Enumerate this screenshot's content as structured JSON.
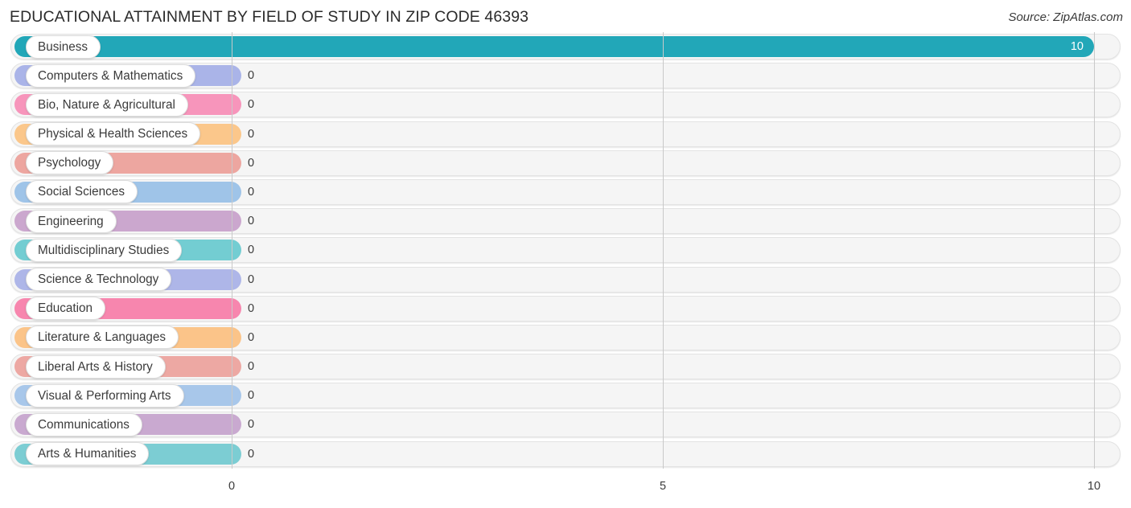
{
  "header": {
    "title": "EDUCATIONAL ATTAINMENT BY FIELD OF STUDY IN ZIP CODE 46393",
    "source": "Source: ZipAtlas.com"
  },
  "axis": {
    "ticks": [
      "0",
      "5",
      "10"
    ],
    "tick_values": [
      0,
      5,
      10
    ]
  },
  "chart_data": {
    "type": "bar",
    "orientation": "horizontal",
    "title": "EDUCATIONAL ATTAINMENT BY FIELD OF STUDY IN ZIP CODE 46393",
    "subtitle": "",
    "xlabel": "",
    "ylabel": "",
    "xlim": [
      0,
      10
    ],
    "grid": true,
    "legend": null,
    "source": "Source: ZipAtlas.com",
    "categories": [
      "Business",
      "Computers & Mathematics",
      "Bio, Nature & Agricultural",
      "Physical & Health Sciences",
      "Psychology",
      "Social Sciences",
      "Engineering",
      "Multidisciplinary Studies",
      "Science & Technology",
      "Education",
      "Literature & Languages",
      "Liberal Arts & History",
      "Visual & Performing Arts",
      "Communications",
      "Arts & Humanities"
    ],
    "values": [
      10,
      0,
      0,
      0,
      0,
      0,
      0,
      0,
      0,
      0,
      0,
      0,
      0,
      0,
      0
    ],
    "value_labels": [
      "10",
      "0",
      "0",
      "0",
      "0",
      "0",
      "0",
      "0",
      "0",
      "0",
      "0",
      "0",
      "0",
      "0",
      "0"
    ],
    "colors": [
      "#22a7b8",
      "#aab4e8",
      "#f795bb",
      "#fbc78b",
      "#eda6a0",
      "#9fc4e8",
      "#cba7ce",
      "#73cdd2",
      "#aeb6e8",
      "#f786ae",
      "#fbc489",
      "#eda8a3",
      "#a8c7ea",
      "#c9a9d0",
      "#7ccdd3"
    ]
  },
  "rows": [
    {
      "label": "Business",
      "value": 10,
      "value_label": "10",
      "color": "#22a7b8",
      "value_inside": true
    },
    {
      "label": "Computers & Mathematics",
      "value": 0,
      "value_label": "0",
      "color": "#aab4e8",
      "value_inside": false
    },
    {
      "label": "Bio, Nature & Agricultural",
      "value": 0,
      "value_label": "0",
      "color": "#f795bb",
      "value_inside": false
    },
    {
      "label": "Physical & Health Sciences",
      "value": 0,
      "value_label": "0",
      "color": "#fbc78b",
      "value_inside": false
    },
    {
      "label": "Psychology",
      "value": 0,
      "value_label": "0",
      "color": "#eda6a0",
      "value_inside": false
    },
    {
      "label": "Social Sciences",
      "value": 0,
      "value_label": "0",
      "color": "#9fc4e8",
      "value_inside": false
    },
    {
      "label": "Engineering",
      "value": 0,
      "value_label": "0",
      "color": "#cba7ce",
      "value_inside": false
    },
    {
      "label": "Multidisciplinary Studies",
      "value": 0,
      "value_label": "0",
      "color": "#73cdd2",
      "value_inside": false
    },
    {
      "label": "Science & Technology",
      "value": 0,
      "value_label": "0",
      "color": "#aeb6e8",
      "value_inside": false
    },
    {
      "label": "Education",
      "value": 0,
      "value_label": "0",
      "color": "#f786ae",
      "value_inside": false
    },
    {
      "label": "Literature & Languages",
      "value": 0,
      "value_label": "0",
      "color": "#fbc489",
      "value_inside": false
    },
    {
      "label": "Liberal Arts & History",
      "value": 0,
      "value_label": "0",
      "color": "#eda8a3",
      "value_inside": false
    },
    {
      "label": "Visual & Performing Arts",
      "value": 0,
      "value_label": "0",
      "color": "#a8c7ea",
      "value_inside": false
    },
    {
      "label": "Communications",
      "value": 0,
      "value_label": "0",
      "color": "#c9a9d0",
      "value_inside": false
    },
    {
      "label": "Arts & Humanities",
      "value": 0,
      "value_label": "0",
      "color": "#7ccdd3",
      "value_inside": false
    }
  ]
}
